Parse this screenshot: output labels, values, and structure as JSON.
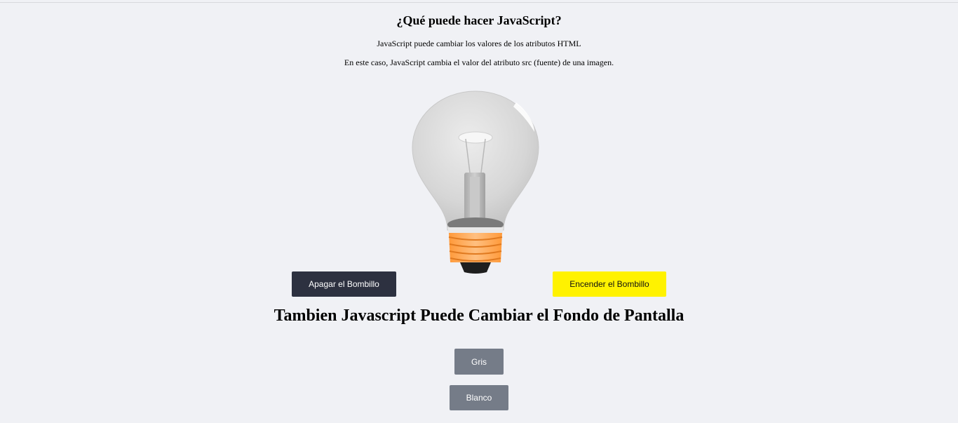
{
  "header": {
    "title": "¿Qué puede hacer JavaScript?",
    "line1": "JavaScript puede cambiar los valores de los atributos HTML",
    "line2": "En este caso, JavaScript cambia el valor del atributo src (fuente) de una imagen."
  },
  "bulb": {
    "state": "off",
    "glass_color": "#dcdcdc",
    "base_color": "#ffa64d"
  },
  "buttons": {
    "off_label": "Apagar el Bombillo",
    "on_label": "Encender el Bombillo"
  },
  "background_section": {
    "title": "Tambien Javascript Puede Cambiar el Fondo de Pantalla",
    "gray_label": "Gris",
    "white_label": "Blanco"
  },
  "colors": {
    "page_background": "#f0f1f5",
    "off_button": "#2d3140",
    "on_button": "#fff200",
    "bg_buttons": "#757c88"
  }
}
